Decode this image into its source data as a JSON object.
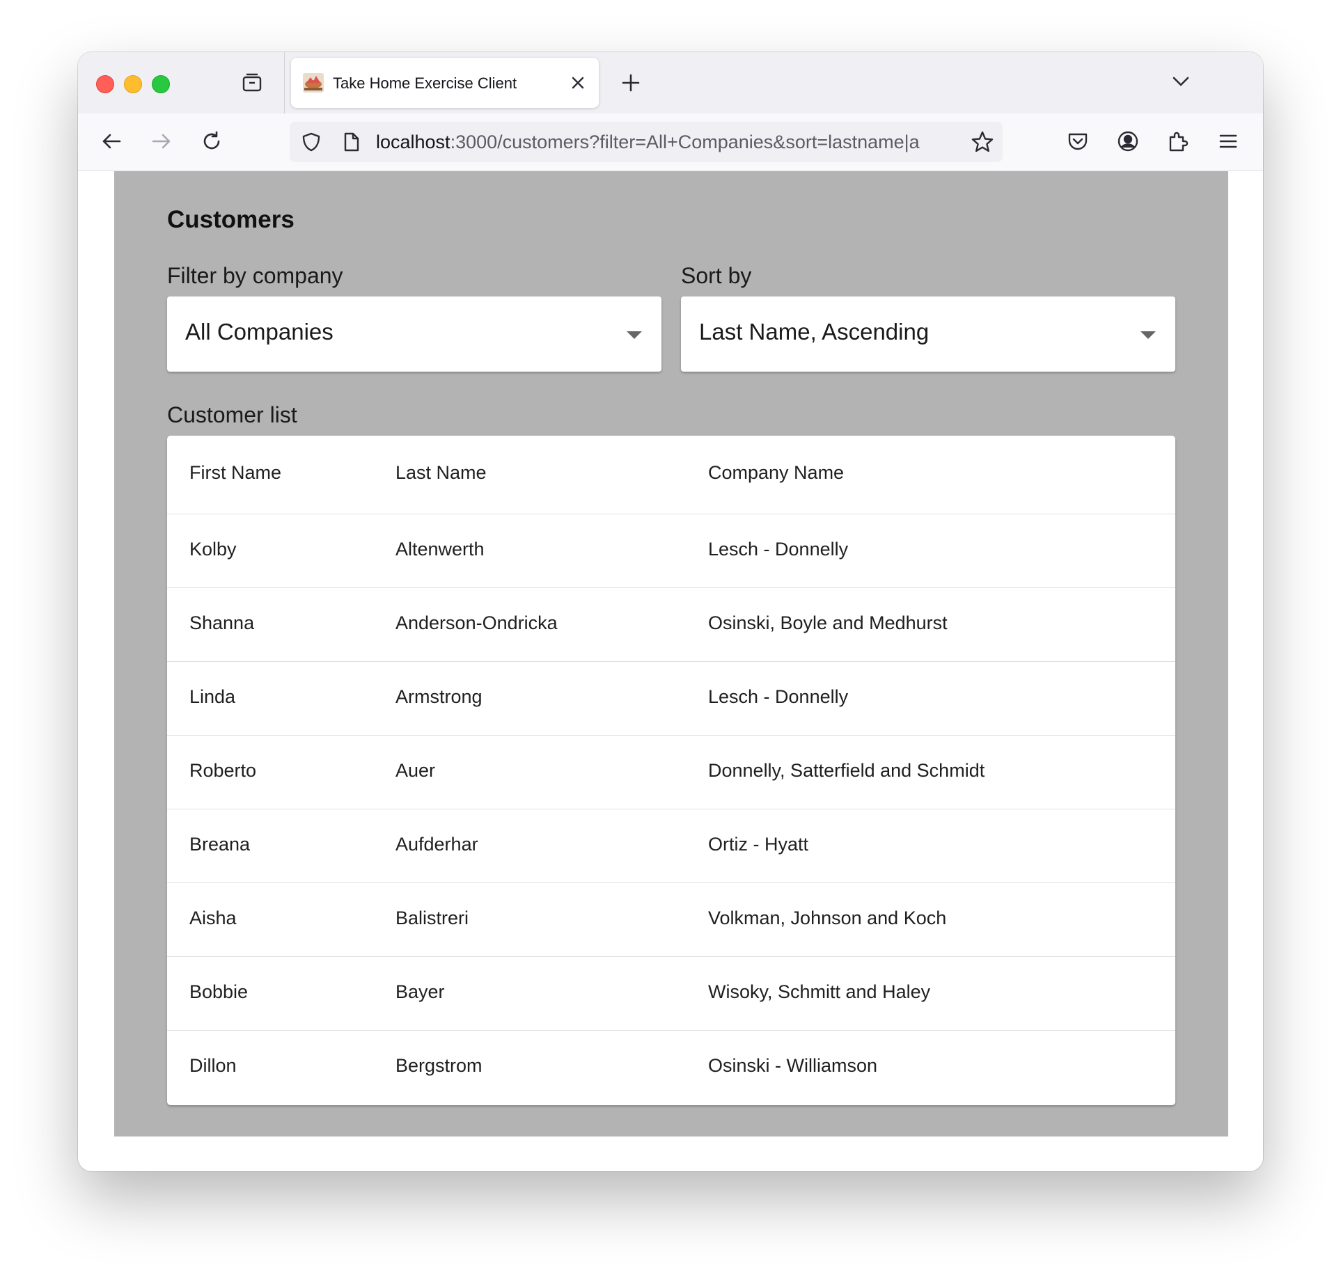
{
  "browser": {
    "tab_title": "Take Home Exercise Client",
    "url_host": "localhost",
    "url_rest": ":3000/customers?filter=All+Companies&sort=lastname|a"
  },
  "page": {
    "title": "Customers",
    "filter_label": "Filter by company",
    "filter_value": "All Companies",
    "sort_label": "Sort by",
    "sort_value": "Last Name, Ascending",
    "list_label": "Customer list"
  },
  "table": {
    "headers": [
      "First Name",
      "Last Name",
      "Company Name"
    ],
    "rows": [
      [
        "Kolby",
        "Altenwerth",
        "Lesch - Donnelly"
      ],
      [
        "Shanna",
        "Anderson-Ondricka",
        "Osinski, Boyle and Medhurst"
      ],
      [
        "Linda",
        "Armstrong",
        "Lesch - Donnelly"
      ],
      [
        "Roberto",
        "Auer",
        "Donnelly, Satterfield and Schmidt"
      ],
      [
        "Breana",
        "Aufderhar",
        "Ortiz - Hyatt"
      ],
      [
        "Aisha",
        "Balistreri",
        "Volkman, Johnson and Koch"
      ],
      [
        "Bobbie",
        "Bayer",
        "Wisoky, Schmitt and Haley"
      ],
      [
        "Dillon",
        "Bergstrom",
        "Osinski - Williamson"
      ]
    ]
  },
  "icons": {
    "tab_manager": "tab-manager-icon",
    "new_tab": "plus-icon",
    "tab_list": "chevron-down-icon",
    "back": "back-arrow-icon",
    "forward": "forward-arrow-icon",
    "reload": "reload-icon",
    "tracking": "shield-icon",
    "page_info": "page-icon",
    "bookmark": "star-icon",
    "pocket": "pocket-icon",
    "account": "account-icon",
    "extensions": "puzzle-icon",
    "menu": "hamburger-menu-icon"
  },
  "colors": {
    "panel_background": "#b3b3b3",
    "traffic_close": "#ff5f57",
    "traffic_minimize": "#febc2e",
    "traffic_maximize": "#28c840"
  }
}
